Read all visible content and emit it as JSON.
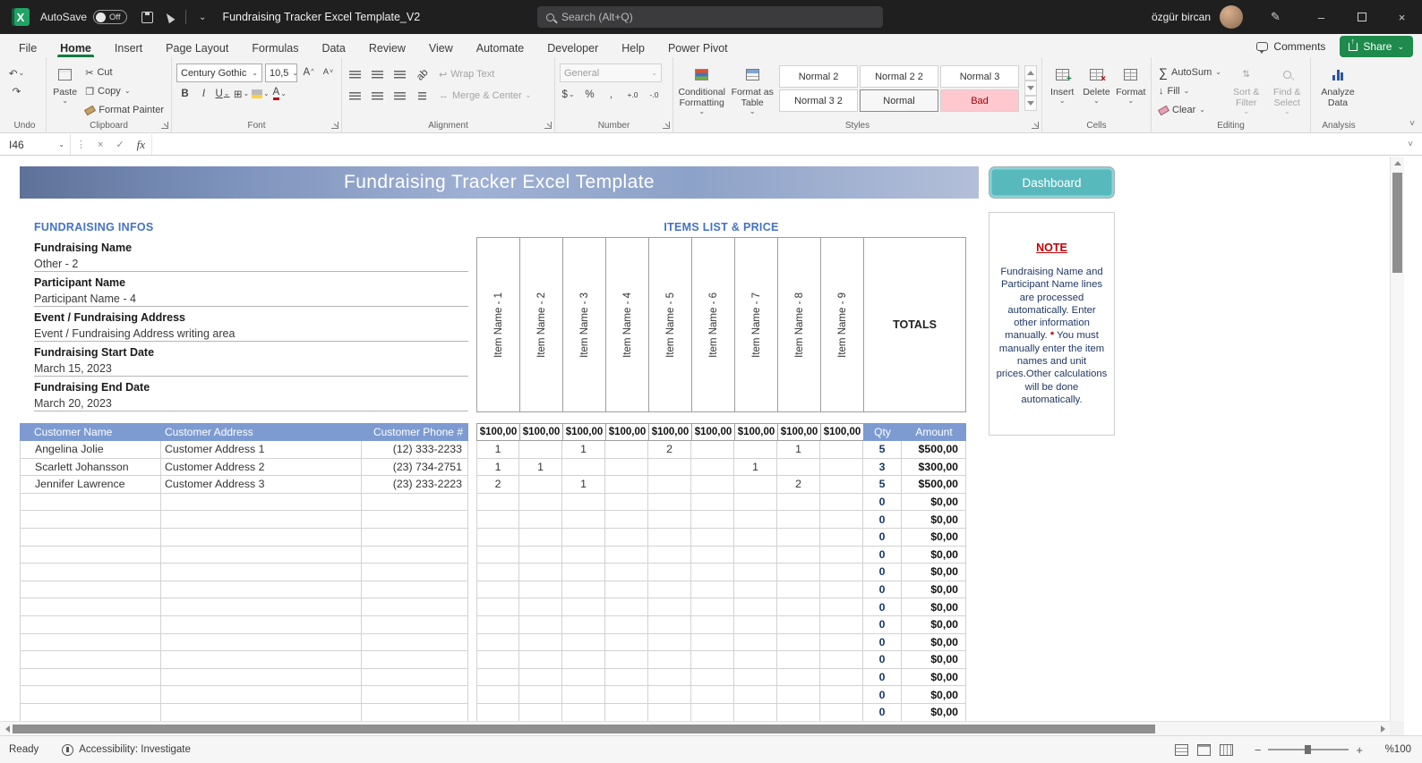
{
  "icons": {
    "caret_down": "⌄",
    "caret_small": "˅",
    "undo": "↶",
    "redo": "↷",
    "cut": "✂",
    "copy": "❐",
    "sigma": "∑",
    "fill_down": "↓",
    "sort": "⇅",
    "percent": "%",
    "comma": ",",
    "inc_dec": "+.0",
    "dec_dec": "-.0",
    "currency": "$",
    "bold": "B",
    "italic": "I",
    "underline": "U",
    "borders": "⊞",
    "close": "×",
    "check": "✓",
    "minimize": "–",
    "dots": "⋮",
    "pen": "✎",
    "wrap": "↩",
    "merge": "↔"
  },
  "titlebar": {
    "autosave_label": "AutoSave",
    "autosave_state": "Off",
    "doc_title": "Fundraising Tracker Excel Template_V2",
    "search_placeholder": "Search (Alt+Q)",
    "user_name": "özgür bircan"
  },
  "ribbon": {
    "tabs": [
      "File",
      "Home",
      "Insert",
      "Page Layout",
      "Formulas",
      "Data",
      "Review",
      "View",
      "Automate",
      "Developer",
      "Help",
      "Power Pivot"
    ],
    "active_tab": "Home",
    "comments": "Comments",
    "share": "Share",
    "groups": {
      "undo": {
        "label": "Undo"
      },
      "clipboard": {
        "label": "Clipboard",
        "paste": "Paste",
        "cut": "Cut",
        "copy": "Copy",
        "format_painter": "Format Painter"
      },
      "font": {
        "label": "Font",
        "font_name": "Century Gothic",
        "font_size": "10,5"
      },
      "alignment": {
        "label": "Alignment",
        "wrap_text": "Wrap Text",
        "merge_center": "Merge & Center"
      },
      "number": {
        "label": "Number",
        "format": "General"
      },
      "styles": {
        "label": "Styles",
        "conditional_line1": "Conditional",
        "conditional_line2": "Formatting",
        "format_table_line1": "Format as",
        "format_table_line2": "Table",
        "gallery": [
          "Normal 2",
          "Normal 2 2",
          "Normal 3",
          "Normal 3 2",
          "Normal",
          "Bad"
        ],
        "selected_style": "Normal",
        "bad_style": "Bad"
      },
      "cells": {
        "label": "Cells",
        "insert": "Insert",
        "delete": "Delete",
        "format": "Format"
      },
      "editing": {
        "label": "Editing",
        "autosum": "AutoSum",
        "fill": "Fill",
        "clear": "Clear",
        "sort_line1": "Sort &",
        "sort_line2": "Filter",
        "find_line1": "Find &",
        "find_line2": "Select"
      },
      "analysis": {
        "label": "Analysis",
        "analyze_line1": "Analyze",
        "analyze_line2": "Data"
      }
    }
  },
  "formula_bar": {
    "name_box": "I46",
    "fx": "fx"
  },
  "sheet": {
    "banner_title": "Fundraising Tracker Excel Template",
    "dashboard_button": "Dashboard",
    "infos": {
      "heading": "FUNDRAISING INFOS",
      "fields": [
        {
          "label": "Fundraising Name",
          "value": "Other - 2"
        },
        {
          "label": "Participant Name",
          "value": "Participant Name - 4"
        },
        {
          "label": "Event / Fundraising Address",
          "value": "Event / Fundraising Address writing area"
        },
        {
          "label": "Fundraising Start Date",
          "value": "March 15, 2023"
        },
        {
          "label": "Fundraising End Date",
          "value": "March 20, 2023"
        }
      ]
    },
    "items": {
      "heading": "ITEMS LIST & PRICE",
      "item_names": [
        "Item Name - 1",
        "Item Name - 2",
        "Item Name - 3",
        "Item Name - 4",
        "Item Name - 5",
        "Item Name - 6",
        "Item Name - 7",
        "Item Name - 8",
        "Item Name - 9"
      ],
      "totals_label": "TOTALS",
      "unit_prices": [
        "$100,00",
        "$100,00",
        "$100,00",
        "$100,00",
        "$100,00",
        "$100,00",
        "$100,00",
        "$100,00",
        "$100,00"
      ]
    },
    "table": {
      "headers": {
        "name": "Customer Name",
        "address": "Customer Address",
        "phone": "Customer Phone #",
        "qty": "Qty",
        "amount": "Amount"
      },
      "rows": [
        {
          "name": "Angelina Jolie",
          "address": "Customer Address 1",
          "phone": "(12) 333-2233",
          "quantities": [
            "1",
            "",
            "1",
            "",
            "2",
            "",
            "",
            "1",
            ""
          ],
          "qty": "5",
          "amount": "$500,00"
        },
        {
          "name": "Scarlett Johansson",
          "address": "Customer Address 2",
          "phone": "(23) 734-2751",
          "quantities": [
            "1",
            "1",
            "",
            "",
            "",
            "",
            "1",
            "",
            ""
          ],
          "qty": "3",
          "amount": "$300,00"
        },
        {
          "name": "Jennifer Lawrence",
          "address": "Customer Address 3",
          "phone": "(23) 233-2223",
          "quantities": [
            "2",
            "",
            "1",
            "",
            "",
            "",
            "",
            "2",
            ""
          ],
          "qty": "5",
          "amount": "$500,00"
        }
      ],
      "empty_row_count": 13,
      "empty_row_qty": "0",
      "empty_row_amount": "$0,00"
    },
    "note": {
      "heading": "NOTE",
      "body1": "Fundraising Name and Participant Name lines are processed automatically. Enter other information manually.",
      "asterisk": "*",
      "body2": " You must manually enter the item names and unit prices.Other calculations will be done automatically."
    }
  },
  "status_bar": {
    "ready": "Ready",
    "accessibility": "Accessibility: Investigate",
    "zoom": "%100"
  }
}
